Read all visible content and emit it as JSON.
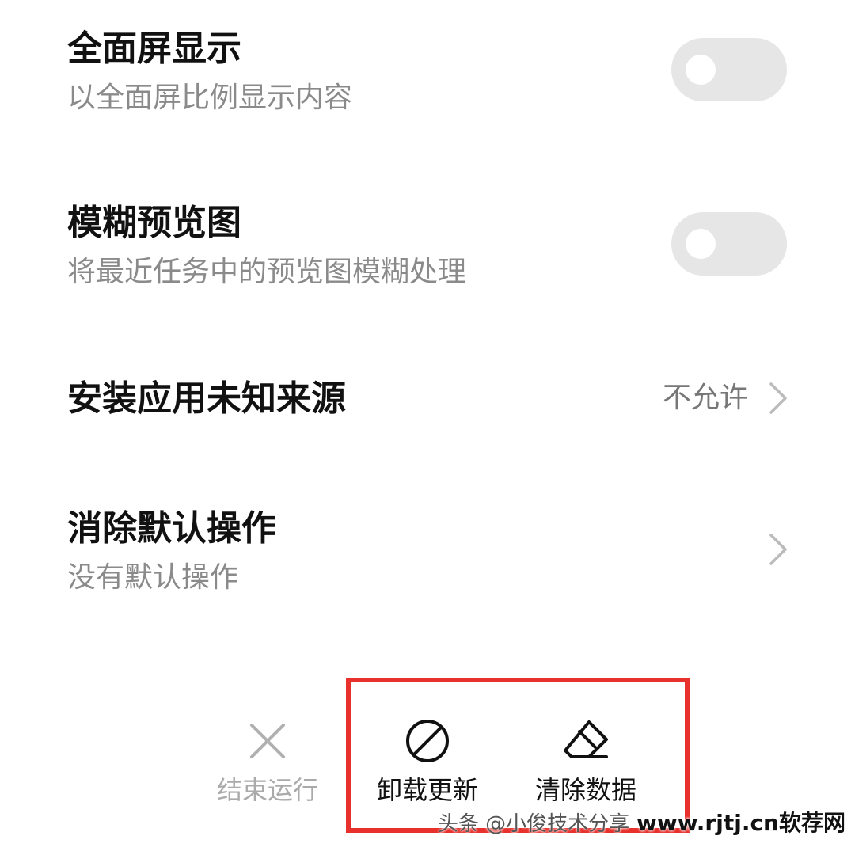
{
  "settings": {
    "fullscreen": {
      "title": "全面屏显示",
      "subtitle": "以全面屏比例显示内容",
      "enabled": false
    },
    "blur_preview": {
      "title": "模糊预览图",
      "subtitle": "将最近任务中的预览图模糊处理",
      "enabled": false
    },
    "unknown_sources": {
      "title": "安装应用未知来源",
      "value": "不允许"
    },
    "clear_defaults": {
      "title": "消除默认操作",
      "subtitle": "没有默认操作"
    }
  },
  "actions": {
    "force_stop": {
      "label": "结束运行",
      "icon": "close-icon",
      "enabled": false
    },
    "uninstall_updates": {
      "label": "卸载更新",
      "icon": "prohibited-icon",
      "enabled": true
    },
    "clear_data": {
      "label": "清除数据",
      "icon": "eraser-icon",
      "enabled": true
    }
  },
  "watermark": {
    "text": "www.rjtj.cn软荐网",
    "under_text": "头条 @小俊技术分享"
  },
  "colors": {
    "highlight": "#e8302c",
    "toggle_off": "#e6e6e6",
    "disabled_text": "#aaaaaa"
  }
}
